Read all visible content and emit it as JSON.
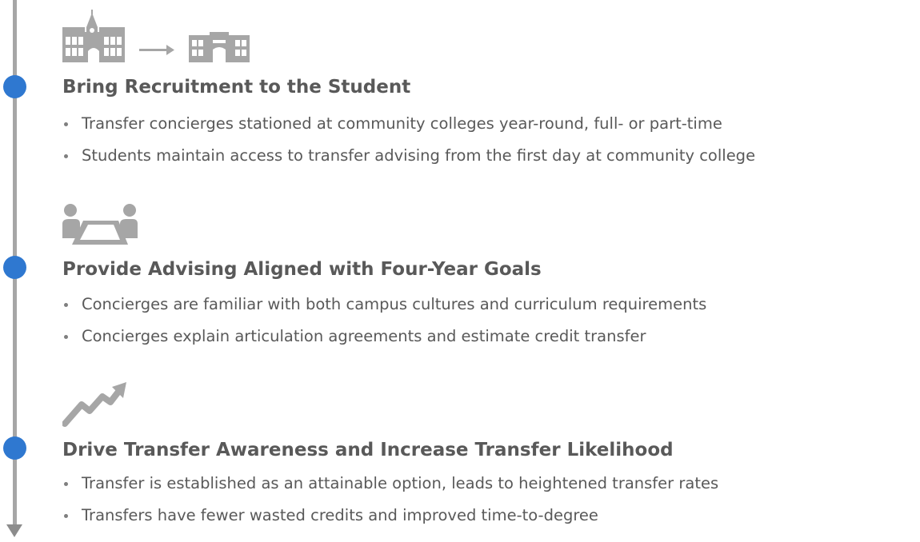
{
  "sections": [
    {
      "icon": "buildings-transfer-icon",
      "heading": "Bring Recruitment to the Student",
      "bullets": [
        "Transfer concierges stationed at community colleges year-round, full- or part-time",
        "Students maintain access to transfer advising from the first day at community college"
      ]
    },
    {
      "icon": "advising-meeting-icon",
      "heading": "Provide Advising Aligned with Four-Year Goals",
      "bullets": [
        "Concierges are familiar with both campus cultures and curriculum requirements",
        "Concierges explain articulation agreements and estimate credit transfer"
      ]
    },
    {
      "icon": "upward-trend-icon",
      "heading": "Drive Transfer Awareness and Increase Transfer Likelihood",
      "bullets": [
        "Transfer is established as an attainable option, leads to heightened transfer rates",
        "Transfers have fewer wasted credits and improved time-to-degree"
      ]
    }
  ],
  "colors": {
    "dot": "#2f78d0",
    "text": "#595959",
    "line": "#a6a6a6",
    "icon": "#a6a6a6"
  }
}
